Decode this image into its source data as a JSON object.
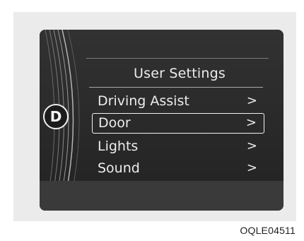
{
  "menu": {
    "title": "User Settings",
    "items": [
      {
        "label": "Driving Assist",
        "chevron": ">"
      },
      {
        "label": "Door",
        "chevron": ">",
        "selected": true
      },
      {
        "label": "Lights",
        "chevron": ">"
      },
      {
        "label": "Sound",
        "chevron": ">"
      }
    ]
  },
  "gear_indicator": "D",
  "image_code": "OQLE04511",
  "colors": {
    "screen_background": "#2b2b2b",
    "text": "#ececec",
    "panel": "#ebebeb"
  }
}
